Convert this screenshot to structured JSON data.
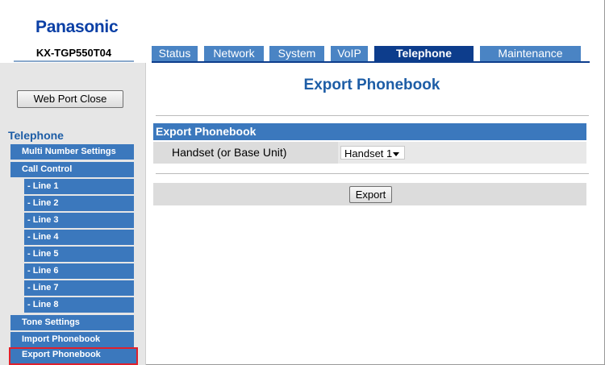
{
  "header": {
    "logo": "Panasonic",
    "model": "KX-TGP550T04"
  },
  "tabs": [
    {
      "label": "Status"
    },
    {
      "label": "Network"
    },
    {
      "label": "System"
    },
    {
      "label": "VoIP"
    },
    {
      "label": "Telephone",
      "active": true
    },
    {
      "label": "Maintenance"
    }
  ],
  "sidebar": {
    "web_port_close": "Web Port Close",
    "section": "Telephone",
    "items": [
      {
        "label": "Multi Number Settings"
      },
      {
        "label": "Call Control"
      },
      {
        "label": "- Line 1"
      },
      {
        "label": "- Line 2"
      },
      {
        "label": "- Line 3"
      },
      {
        "label": "- Line 4"
      },
      {
        "label": "- Line 5"
      },
      {
        "label": "- Line 6"
      },
      {
        "label": "- Line 7"
      },
      {
        "label": "- Line 8"
      },
      {
        "label": "Tone Settings"
      },
      {
        "label": "Import Phonebook"
      },
      {
        "label": "Export Phonebook",
        "selected": true
      }
    ]
  },
  "main": {
    "title": "Export Phonebook",
    "section_header": "Export Phonebook",
    "field_label": "Handset (or Base Unit)",
    "field_value": "Handset 1",
    "export_button": "Export"
  },
  "colors": {
    "brand": "#0a3fa5",
    "tab": "#4a84c4",
    "tab_active": "#0d3d8c",
    "menu": "#3b78bd",
    "selected_outline": "#e0202b"
  }
}
